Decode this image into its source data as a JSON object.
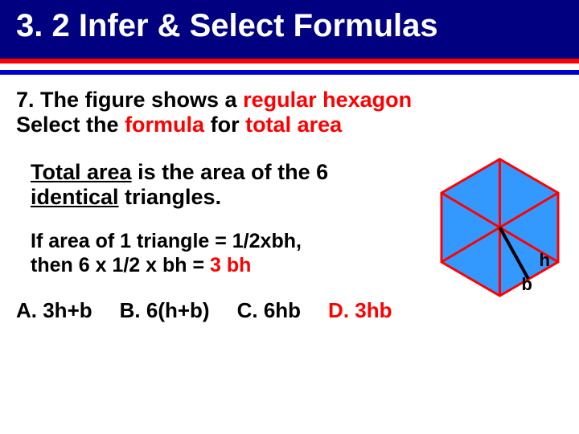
{
  "header": {
    "title": "3. 2 Infer & Select Formulas"
  },
  "question": {
    "prefix": "7. The figure shows a ",
    "highlight1": "regular hexagon",
    "line2a": "Select the ",
    "highlight2": "formula",
    "line2b": " for ",
    "highlight3": "total area"
  },
  "hint": {
    "part1": "Total area",
    "part2": " is the area of the 6 ",
    "part3": "identical",
    "part4": " triangles."
  },
  "formula": {
    "line1": "If area of 1 triangle = 1/2xbh,",
    "line2a": "then   6  x  1/2  x  bh  =  ",
    "line2b": "3 bh"
  },
  "labels": {
    "h": "h",
    "b": "b"
  },
  "options": {
    "a": "A.  3h+b",
    "b": "B. 6(h+b)",
    "c": "C. 6hb",
    "d": "D. 3hb"
  },
  "colors": {
    "header_bg": "#000080",
    "accent_red": "#ff0000",
    "accent_blue": "#0000cc",
    "hex_fill": "#3399ff",
    "hex_stroke": "#ff0000"
  }
}
